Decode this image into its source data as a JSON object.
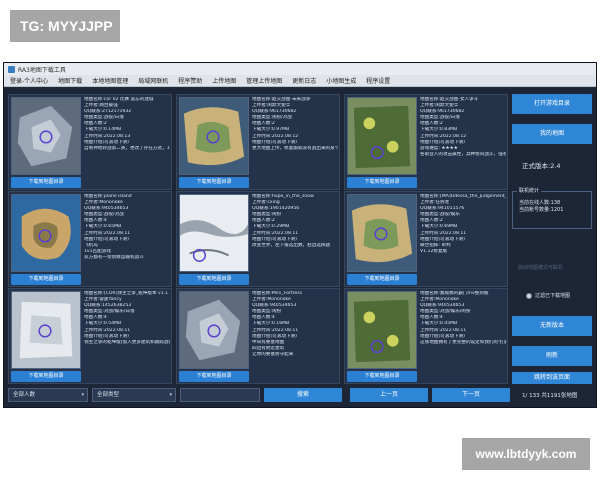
{
  "watermark_top_left": "TG: MYYJJPP",
  "watermark_bottom_right": "www.lbtdyyk.com",
  "window": {
    "title": "RA3地图下载工具"
  },
  "menu": [
    "登录-个人中心",
    "地图下载",
    "本地地图管理",
    "局域网联机",
    "程序赞助",
    "上传地图",
    "管理上传地图",
    "更新日志",
    "小地图生成",
    "程序设置"
  ],
  "cards": [
    {
      "lines": [
        "地图名称:cor 02 比赛 遗忘的迷城",
        "上传者:两台最强",
        "QQ联系:2712171932",
        "地图类型:战役/日落",
        "地图人数:2",
        "下载大小:0.14MB",
        "上传时间:2022.08.13",
        "地图介绍(可滚动下滑)",
        "自制神地转战第二关，更改了存在方式，1-2传说为神转乾坤"
      ],
      "button": "下载到地图目录",
      "thumb": "grey-dark"
    },
    {
      "lines": [
        "地图名称:超交战图-未来战争",
        "上传者:闲默大使丰",
        "QQ联系:961730682",
        "地图类型:闲扮/对战",
        "地图人数:2",
        "下载大小:0.97MB",
        "上传时间:2022.08.12",
        "地图介绍(可滚动下滑)",
        "更大地图上传，修复跟踪没有战出来的某个大战等新大图"
      ],
      "button": "下载到地图目录",
      "thumb": "sand"
    },
    {
      "lines": [
        "地图名称:超交战图-女人争斗",
        "上传者:闲默大使丰",
        "QQ联系:961730682",
        "地图类型:战役/日落",
        "地图人数:2",
        "下载大小:0.83MB",
        "上传时间:2022.08.12",
        "地图介绍(可滚动下滑)",
        "游戏难度: ★★★★",
        "各职业人的攻击属性，兵种协同战斗，强有效对比"
      ],
      "button": "下载到地图目录",
      "thumb": "green"
    },
    {
      "lines": [
        "地图名称:plane island",
        "上传者:Mononoke",
        "QQ联系:940534653",
        "地图类型:战役/对战",
        "地图人数:4",
        "下载大小:0.65MB",
        "上传时间:2022.08.11",
        "地图介绍(可滚动下滑)",
        "飞机岛",
        "1v1匹配游戏",
        "双方都有一架侦察运输机战斗"
      ],
      "button": "下载到地图目录",
      "thumb": "island"
    },
    {
      "lines": [
        "地图名称:hope_in_the_snow",
        "上传者:cxing",
        "QQ联系:1901420956",
        "地图类型:闲扮",
        "地图人数:2",
        "下载大小:0.29MB",
        "上传时间:2022.08.11",
        "地图介绍(可滚动下滑)",
        "改变世界，左下角选出数，右边选择题"
      ],
      "button": "下载到地图目录",
      "thumb": "snow"
    },
    {
      "lines": [
        "地图名称:[MA]Odessa_the_Judgement_v1.12EV",
        "上传者:任燕龙",
        "QQ联系:941011576",
        "地图类型:战役/娱乐",
        "地图人数:2",
        "下载大小:0.69MB",
        "上传时间:2022.08.11",
        "地图介绍(可滚动下滑)",
        "联合指挥: 审判",
        "V1.12修复版"
      ],
      "button": "下载到地图目录",
      "thumb": "sand"
    },
    {
      "lines": [
        "地图名称:[COR]领主之争_乾坤版本 v1.1",
        "上传者:雷霆Yancy",
        "QQ联系:1452638253",
        "地图类型:对战/娱乐/日落",
        "地图人数:4",
        "下载大小:0.54MB",
        "上传时间:2022.08.11",
        "地图介绍(可滚动下滑)",
        "领主之争的乾坤版(加入更多建筑和跟踪战役地图)特别的领主设定"
      ],
      "button": "下载到地图目录",
      "thumb": "white"
    },
    {
      "lines": [
        "地图名称:Mini_Fortress",
        "上传者:Mononoke",
        "QQ联系:940534653",
        "地图类型:闲扮",
        "地图人数:4",
        "下载大小:0.16MB",
        "上传时间:2022.08.11",
        "地图介绍(可滚动下滑)",
        "中间有要塞地图",
        "四边有附近建筑",
        "让你的要塞防守起来"
      ],
      "button": "下载到地图目录",
      "thumb": "grey-dark"
    },
    {
      "lines": [
        "地图名称:素敌模的霸门mv整刻版",
        "上传者:Mononoke",
        "QQ联系:940534653",
        "地图类型:对战/娱乐/闲扮",
        "地图人数:4",
        "下载大小:0.45MB",
        "上传时间:2022.08.11",
        "地图介绍(可滚动下滑)",
        "这张地图拥有了更完整的设定和我们的'打赢了'的'智能型'"
      ],
      "button": "下载到地图目录",
      "thumb": "green"
    }
  ],
  "right_panel": {
    "open_folder": "打开游戏目录",
    "my_maps": "我的地图",
    "version": "正式版本:2.4",
    "group_title": "联机统计",
    "online_today": "当前在线人数:138",
    "registered": "当前账号数量:1201",
    "dim_label": "启动地图模式可联机",
    "toggle_label": "过滤已下载地图",
    "no_new_version": "无新版本",
    "refresh": "刷新",
    "skip_page": "跳转到该页面"
  },
  "bottom": {
    "player_filter": "全部人数",
    "type_filter": "全部类型",
    "search": "搜索",
    "prev": "上一页",
    "next": "下一页",
    "page_info": "1/ 133 共1191张地图"
  }
}
